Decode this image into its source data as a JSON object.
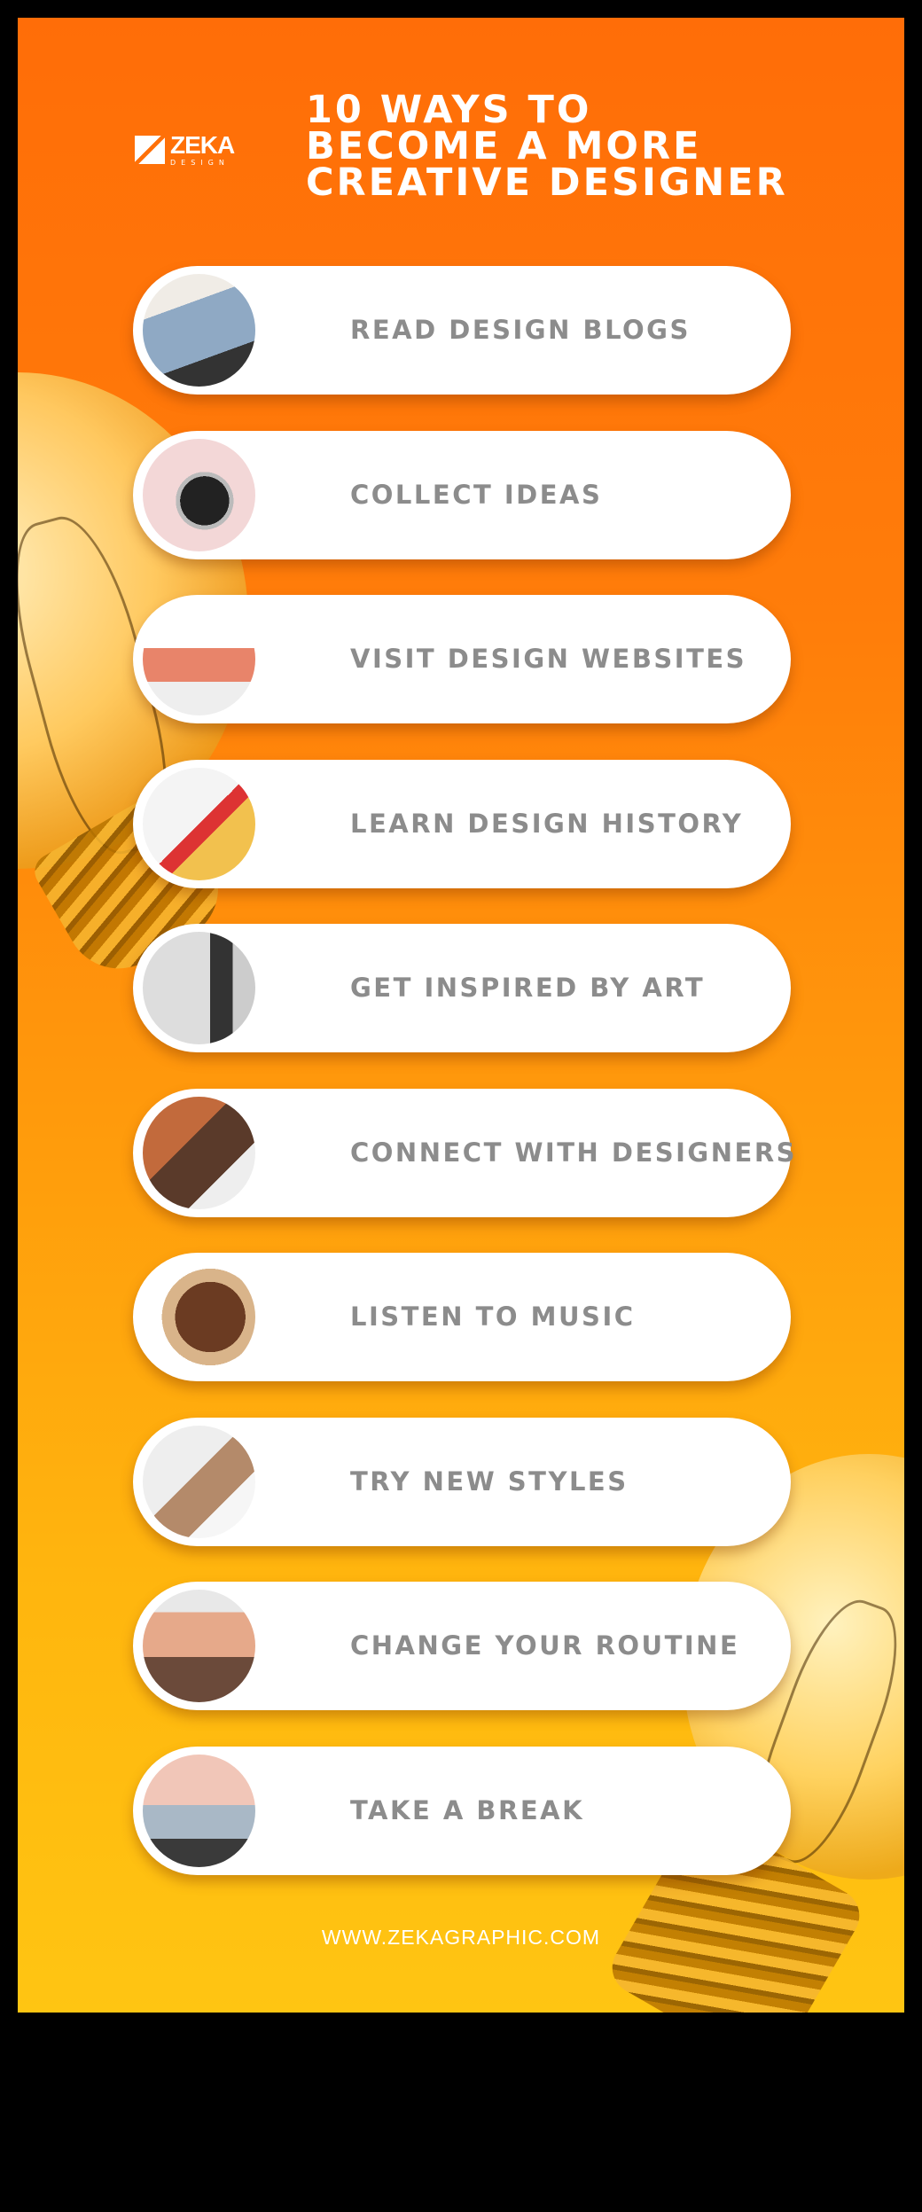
{
  "brand": {
    "name": "ZEKA",
    "sub": "DESIGN"
  },
  "title": {
    "lines": [
      "10 WAYS TO",
      "BECOME A MORE",
      "CREATIVE DESIGNER"
    ]
  },
  "items": [
    {
      "label": "READ DESIGN BLOGS",
      "photo": "woman-with-laptop"
    },
    {
      "label": "COLLECT IDEAS",
      "photo": "hand-holding-camera"
    },
    {
      "label": "VISIT DESIGN WEBSITES",
      "photo": "design-website-screenshot"
    },
    {
      "label": "LEARN DESIGN HISTORY",
      "photo": "bauhaus-book"
    },
    {
      "label": "GET INSPIRED BY ART",
      "photo": "person-in-gallery"
    },
    {
      "label": "CONNECT WITH DESIGNERS",
      "photo": "designers-talking"
    },
    {
      "label": "LISTEN TO MUSIC",
      "photo": "woman-with-headphones"
    },
    {
      "label": "TRY NEW STYLES",
      "photo": "painting-palette"
    },
    {
      "label": "CHANGE YOUR ROUTINE",
      "photo": "man-standing"
    },
    {
      "label": "TAKE A BREAK",
      "photo": "person-on-beach"
    }
  ],
  "footer": {
    "url": "WWW.ZEKAGRAPHIC.COM"
  },
  "colors": {
    "top": "#ff6d08",
    "bottom": "#ffc512",
    "label": "#8c8c8c"
  }
}
